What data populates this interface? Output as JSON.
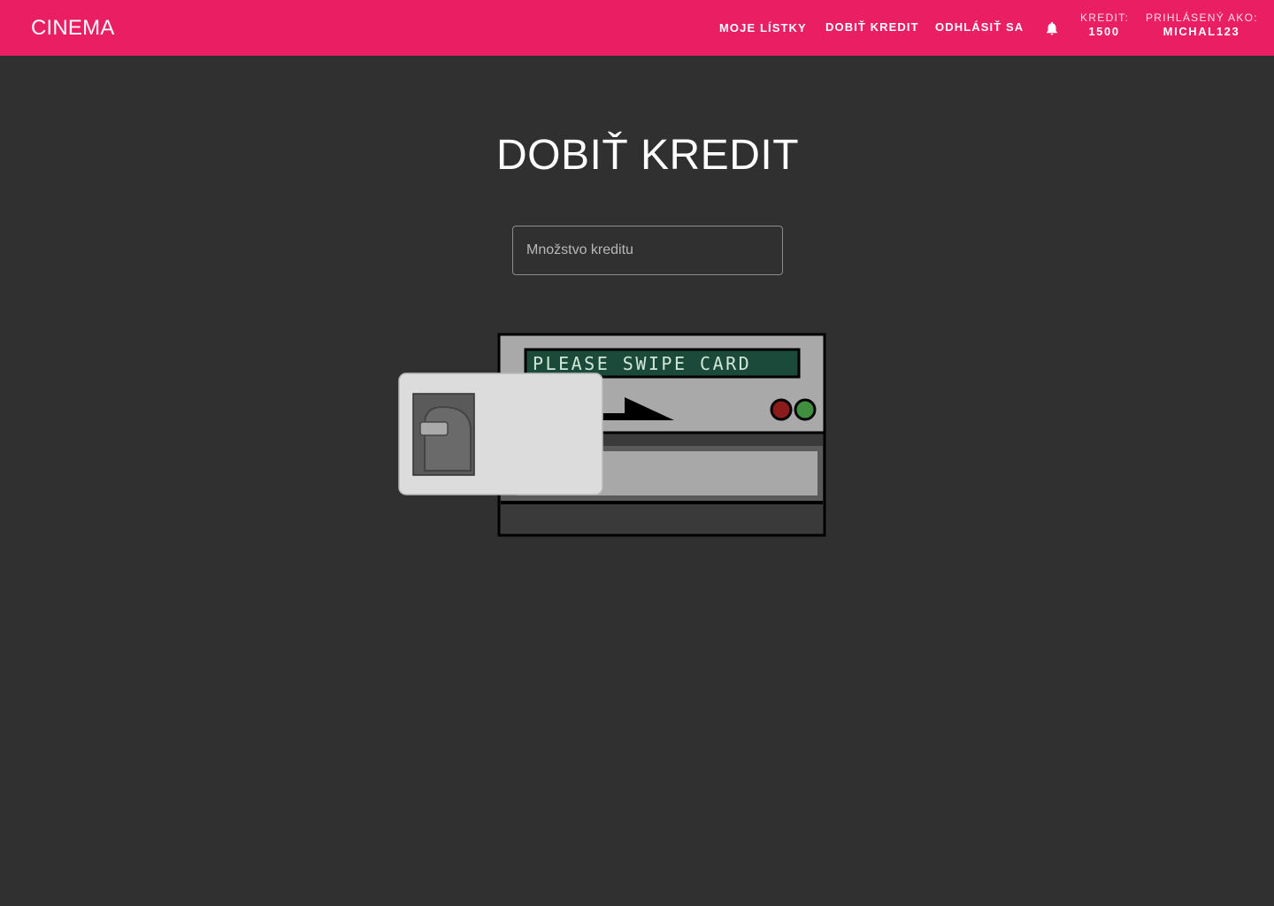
{
  "header": {
    "brand": "CINEMA",
    "nav": {
      "my_tickets": "MOJE LÍSTKY",
      "top_up": "DOBIŤ KREDIT",
      "logout": "ODHLÁSIŤ SA"
    },
    "notifications_icon": "bell-icon",
    "credit": {
      "label": "KREDIT:",
      "value": "1500"
    },
    "user": {
      "label": "PRIHLÁSENÝ AKO:",
      "value": "MICHAL123"
    }
  },
  "main": {
    "title": "DOBIŤ KREDIT",
    "credit_input": {
      "placeholder": "Množstvo kreditu",
      "value": ""
    },
    "card_reader": {
      "display_text": "PLEASE SWIPE CARD",
      "indicator_colors": [
        "#8b1a1a",
        "#3f8f3f"
      ]
    }
  },
  "colors": {
    "accent": "#e91e63",
    "background": "#303030",
    "lcd": "#1c4a3a"
  }
}
